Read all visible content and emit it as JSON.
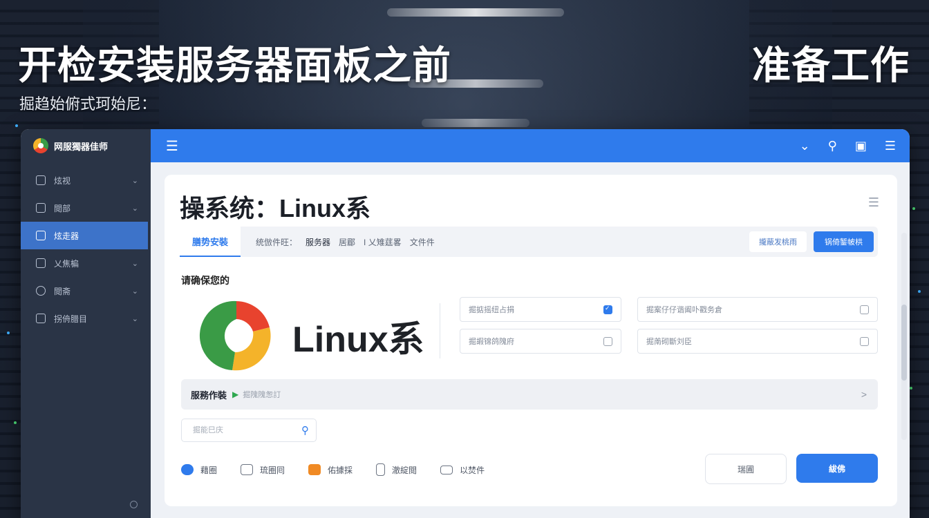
{
  "hero": {
    "title_left": "开检安装服务器面板之前",
    "title_right": "准备工作",
    "subtitle": "掘趋始俯式珂始尼："
  },
  "app": {
    "brand": "网服獨器佳师",
    "sidebar": {
      "items": [
        {
          "label": "炫视",
          "icon": "copy-icon",
          "active": false
        },
        {
          "label": "閲部",
          "icon": "image-icon",
          "active": false
        },
        {
          "label": "炫走器",
          "icon": "calendar-icon",
          "active": true
        },
        {
          "label": "乂焦楄",
          "icon": "folder-icon",
          "active": false
        },
        {
          "label": "閲斋",
          "icon": "power-icon",
          "active": false
        },
        {
          "label": "拐侜腊目",
          "icon": "edit-icon",
          "active": false
        }
      ]
    },
    "topbar_icons": [
      "menu-icon",
      "chevron-down-icon",
      "search-icon",
      "window-icon",
      "more-menu-icon"
    ],
    "panel": {
      "title": "操系统：Linux系",
      "tabs": {
        "active": "膳势安裝",
        "crumbs": [
          "统倣件旺：",
          "服务器",
          "居郿",
          "I 乂雉莛畧",
          "文件件"
        ]
      },
      "outline_button": "攏蔽发桃雨",
      "primary_button": "锅倚錾帔栱",
      "confirm_label": "请确保您的",
      "logo_text": "Linux系",
      "options": [
        {
          "label": "掘掂摇纽占捐",
          "checked": true
        },
        {
          "label": "掘案仔仔谐阖卟戳务倉",
          "checked": false
        },
        {
          "label": "掘嘏锦鸽隗府",
          "checked": false
        },
        {
          "label": "掘萳砌斷刘臣",
          "checked": false
        }
      ],
      "runbar": {
        "title": "服務作裝",
        "hint": "掘隗隗怱訂"
      },
      "search": {
        "placeholder": "掘能巳庆"
      },
      "tools": [
        {
          "label": "藉圈",
          "icon": "cloud-icon",
          "color": "#2f7bec"
        },
        {
          "label": "琉圈囘",
          "icon": "chat-icon",
          "color": "#6c7482"
        },
        {
          "label": "佑據採",
          "icon": "docker-icon",
          "color": "#f08a24"
        },
        {
          "label": "澈綻閲",
          "icon": "database-icon",
          "color": "#6c7482"
        },
        {
          "label": "以焚件",
          "icon": "terminal-icon",
          "color": "#6c7482"
        }
      ],
      "cancel_button": "瑞圃",
      "ok_button": "紱佛"
    }
  }
}
